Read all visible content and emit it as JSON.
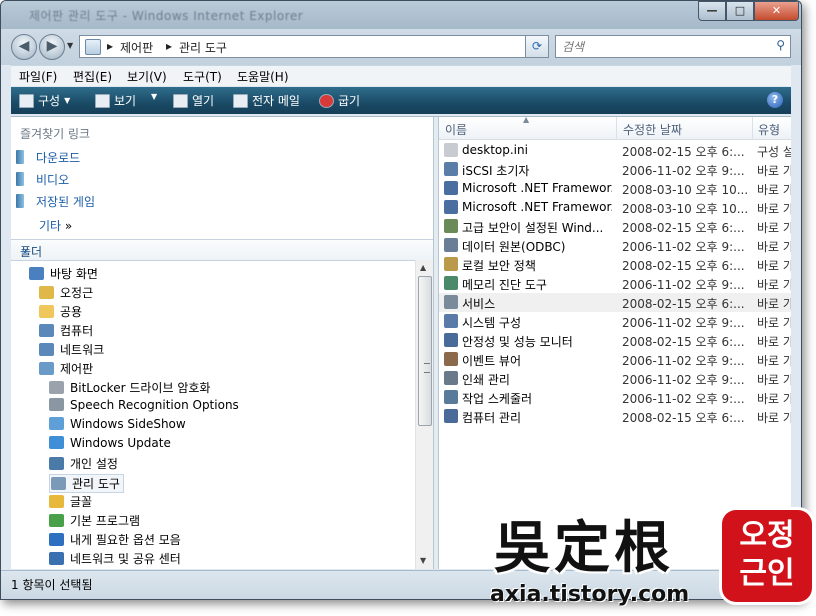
{
  "window": {
    "title_blurred": "제어판 관리 도구 - Windows Internet Explorer",
    "caption_buttons": {
      "minimize": "—",
      "maximize": "□",
      "close": "✕"
    }
  },
  "address": {
    "crumbs": [
      "제어판",
      "관리 도구"
    ],
    "separator": "▸",
    "search_placeholder": "검색"
  },
  "menu": [
    "파일(F)",
    "편집(E)",
    "보기(V)",
    "도구(T)",
    "도움말(H)"
  ],
  "commands": {
    "organize": "구성",
    "view": "보기",
    "open": "열기",
    "email": "전자 메일",
    "burn": "굽기",
    "dropdown": "▼",
    "help": "?"
  },
  "favorites": {
    "header": "즐겨찾기 링크",
    "items": [
      "다운로드",
      "비디오",
      "저장된 게임"
    ],
    "more": "기타",
    "more_chevron": "»"
  },
  "folders": {
    "header": "폴더",
    "chevron": "⌄",
    "tree": [
      {
        "label": "바탕 화면",
        "level": 0,
        "icon": "desktop-icon",
        "color": "#4a7fc0"
      },
      {
        "label": "오정근",
        "level": 1,
        "icon": "user-folder-icon",
        "color": "#e0b84a"
      },
      {
        "label": "공용",
        "level": 1,
        "icon": "folder-icon",
        "color": "#f0c75a"
      },
      {
        "label": "컴퓨터",
        "level": 1,
        "icon": "computer-icon",
        "color": "#5a88b8"
      },
      {
        "label": "네트워크",
        "level": 1,
        "icon": "network-icon",
        "color": "#5a88b8"
      },
      {
        "label": "제어판",
        "level": 1,
        "icon": "control-panel-icon",
        "color": "#6a9ac8"
      },
      {
        "label": "BitLocker 드라이브 암호화",
        "level": 2,
        "icon": "bitlocker-icon",
        "color": "#9aa3ab"
      },
      {
        "label": "Speech Recognition Options",
        "level": 2,
        "icon": "microphone-icon",
        "color": "#8a96a2"
      },
      {
        "label": "Windows SideShow",
        "level": 2,
        "icon": "sideshow-icon",
        "color": "#5f9fd8"
      },
      {
        "label": "Windows Update",
        "level": 2,
        "icon": "windows-update-icon",
        "color": "#3f8fd8"
      },
      {
        "label": "개인 설정",
        "level": 2,
        "icon": "personalization-icon",
        "color": "#4a7aa8"
      },
      {
        "label": "관리 도구",
        "level": 2,
        "icon": "admin-tools-icon",
        "color": "#7a9ab8",
        "selected": true
      },
      {
        "label": "글꼴",
        "level": 2,
        "icon": "fonts-folder-icon",
        "color": "#e8b83a"
      },
      {
        "label": "기본 프로그램",
        "level": 2,
        "icon": "default-programs-icon",
        "color": "#48a048"
      },
      {
        "label": "내게 필요한 옵션 모음",
        "level": 2,
        "icon": "ease-of-access-icon",
        "color": "#2f6fc0"
      },
      {
        "label": "네트워크 및 공유 센터",
        "level": 2,
        "icon": "network-center-icon",
        "color": "#3a6fb0"
      },
      {
        "label": "",
        "level": 2,
        "icon": "partial-item-icon",
        "color": "#3aa050"
      }
    ]
  },
  "list": {
    "columns": {
      "name": "이름",
      "date": "수정한 날짜",
      "type": "유형"
    },
    "sort_indicator": "▲",
    "rows": [
      {
        "name": "desktop.ini",
        "date": "2008-02-15 오후 6:...",
        "type": "구성 설",
        "icon": "ini-file-icon",
        "color": "#c8ccd2"
      },
      {
        "name": "iSCSI 초기자",
        "date": "2006-11-02 오후 9:...",
        "type": "바로 가",
        "icon": "iscsi-shortcut-icon",
        "color": "#5a7ea8"
      },
      {
        "name": "Microsoft .NET Framewor...",
        "date": "2008-03-10 오후 10...",
        "type": "바로 가",
        "icon": "dotnet-shortcut-icon",
        "color": "#4a6ea0"
      },
      {
        "name": "Microsoft .NET Framewor...",
        "date": "2008-03-10 오후 10...",
        "type": "바로 가",
        "icon": "dotnet-shortcut-icon",
        "color": "#4a6ea0"
      },
      {
        "name": "고급 보안이 설정된 Wind...",
        "date": "2008-02-15 오후 6:...",
        "type": "바로 가",
        "icon": "firewall-shortcut-icon",
        "color": "#6a8a5a"
      },
      {
        "name": "데이터 원본(ODBC)",
        "date": "2006-11-02 오후 9:...",
        "type": "바로 가",
        "icon": "odbc-shortcut-icon",
        "color": "#6a7e98"
      },
      {
        "name": "로컬 보안 정책",
        "date": "2008-02-15 오후 6:...",
        "type": "바로 가",
        "icon": "security-policy-shortcut-icon",
        "color": "#b89a4a"
      },
      {
        "name": "메모리 진단 도구",
        "date": "2006-11-02 오후 9:...",
        "type": "바로 가",
        "icon": "memory-diagnostic-shortcut-icon",
        "color": "#4a8a6a"
      },
      {
        "name": "서비스",
        "date": "2008-02-15 오후 6:...",
        "type": "바로 가",
        "icon": "services-shortcut-icon",
        "color": "#7a8a9a",
        "selected": true
      },
      {
        "name": "시스템 구성",
        "date": "2006-11-02 오후 9:...",
        "type": "바로 가",
        "icon": "system-config-shortcut-icon",
        "color": "#5a7aa8"
      },
      {
        "name": "안정성 및 성능 모니터",
        "date": "2008-02-15 오후 6:...",
        "type": "바로 가",
        "icon": "performance-monitor-shortcut-icon",
        "color": "#4a6a9a"
      },
      {
        "name": "이벤트 뷰어",
        "date": "2006-11-02 오후 9:...",
        "type": "바로 가",
        "icon": "event-viewer-shortcut-icon",
        "color": "#8a6a4a"
      },
      {
        "name": "인쇄 관리",
        "date": "2006-11-02 오후 9:...",
        "type": "바로 가",
        "icon": "print-management-shortcut-icon",
        "color": "#6a7a8a"
      },
      {
        "name": "작업 스케줄러",
        "date": "2006-11-02 오후 9:...",
        "type": "바로 가",
        "icon": "task-scheduler-shortcut-icon",
        "color": "#5a7a9a"
      },
      {
        "name": "컴퓨터 관리",
        "date": "2008-02-15 오후 6:...",
        "type": "바로 가",
        "icon": "computer-management-shortcut-icon",
        "color": "#4a6a9a"
      }
    ]
  },
  "status": "1 항목이 선택됨",
  "watermark": {
    "chars": "吳定根",
    "url": "axia.tistory.com",
    "seal_lines": [
      "오정",
      "근인"
    ]
  }
}
